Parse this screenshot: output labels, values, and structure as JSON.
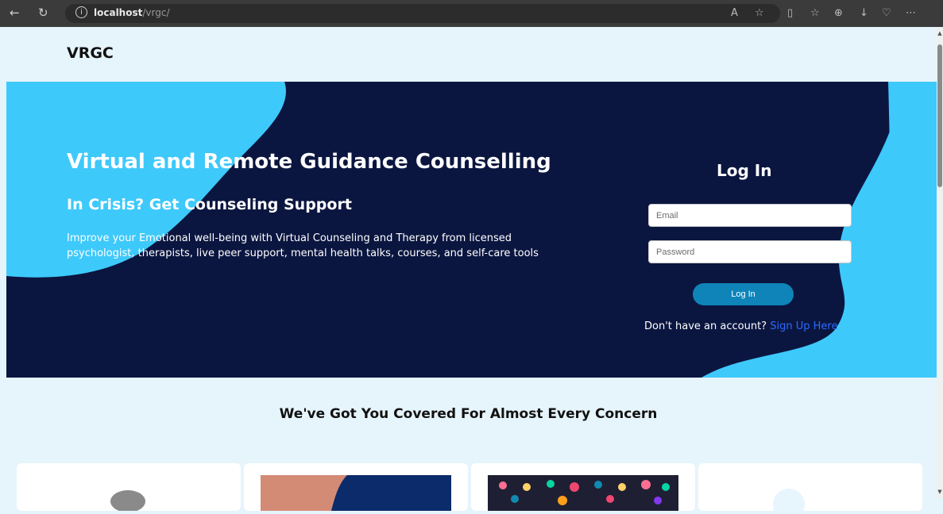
{
  "browser": {
    "url_host": "localhost",
    "url_path": "/vrgc/",
    "icons": [
      "back-icon",
      "refresh-icon",
      "info-icon",
      "read-aloud-icon",
      "favorite-star-icon",
      "split-screen-icon",
      "favorites-icon",
      "collections-icon",
      "downloads-icon",
      "extensions-icon",
      "more-icon"
    ]
  },
  "header": {
    "logo": "VRGC"
  },
  "hero": {
    "title": "Virtual and Remote Guidance Counselling",
    "subtitle": "In Crisis? Get Counseling Support",
    "description": "Improve your Emotional well-being with Virtual Counseling and Therapy from licensed psychologist, therapists, live peer support, mental health talks, courses, and self-care tools"
  },
  "login": {
    "title": "Log In",
    "email_placeholder": "Email",
    "password_placeholder": "Password",
    "button_label": "Log In",
    "signup_prompt": "Don't have an account?",
    "signup_link": "Sign Up Here"
  },
  "section": {
    "title": "We've Got You Covered For Almost Every Concern"
  },
  "colors": {
    "navy": "#0b1640",
    "cyan": "#3ec9fb",
    "button": "#0e84b9",
    "link": "#2a6bff"
  }
}
